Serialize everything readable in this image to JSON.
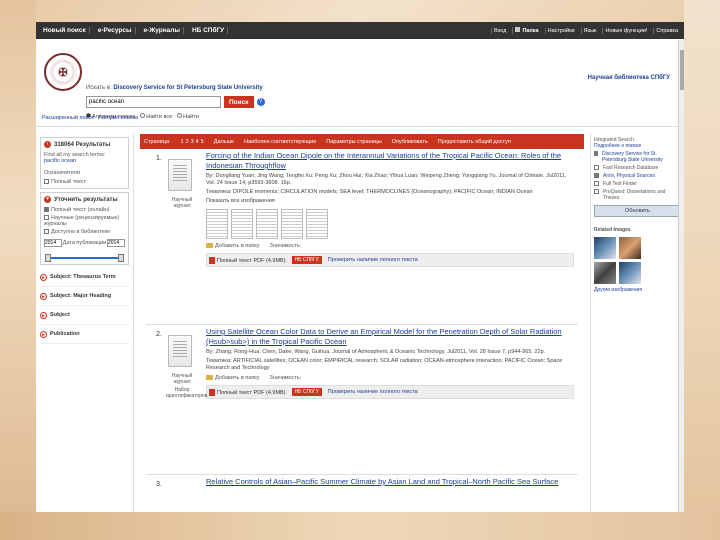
{
  "topbar": {
    "nav": [
      "Новый поиск",
      "e-Ресурсы",
      "e-Журналы",
      "НБ СПбГУ"
    ],
    "right": [
      "Вход",
      "Папка",
      "Настройки",
      "Язык",
      "Новые функции!",
      "Справка"
    ]
  },
  "header": {
    "searching_label": "Искать в:",
    "searching_value": "Discovery Service for St Petersburg State University",
    "query": "pacific ocean",
    "search_button": "Поиск",
    "help": "?",
    "modes": [
      "Алгоритм поиска",
      "Найти все",
      "Найти"
    ],
    "advanced_links": [
      "Расширенный поиск",
      "История поиска"
    ],
    "library_name": "Научная библиотека СПбГУ"
  },
  "left": {
    "results_count": "318064 Результаты",
    "refine_title": "Уточнить результаты",
    "find_all": "Find all my search terms:",
    "find_all_query": "pacific ocean",
    "expanders": "Ограничители",
    "fulltext": "Полный текст",
    "limit_items": [
      "Полный текст (онлайн)",
      "Научные (рецензируемые) журналы",
      "Доступно в библиотеке"
    ],
    "date_from": "2014",
    "date_to": "2014",
    "date_label": "Дата публикации",
    "facets": [
      "Subject: Thesaurus Term",
      "Subject: Major Heading",
      "Subject",
      "Publication"
    ]
  },
  "results": {
    "bar": {
      "label": "Страница:",
      "pages": [
        "1",
        "2",
        "3",
        "4",
        "5"
      ],
      "next": "Дальше",
      "sort": "Наиболее соответствующие",
      "page_options": "Параметры страницы",
      "share": "Опубликовать",
      "alert": "Предоставить общий доступ"
    },
    "items": [
      {
        "num": "1.",
        "title": "Forcing of the Indian Ocean Dipole on the Interannual Variations of the Tropical Pacific Ocean: Roles of the Indonesian Throughflow",
        "meta1": "By: Dongliang Yuan; Jing Wang; Tengfei Xu; Peng Xu; Zhou Hui; Xia Zhao; Yihua Luan; Weipeng Zheng; Yongqiang Yu. Journal of Climate. Jul2011, Vol. 24 Issue 14, p3593-3608. 16p.",
        "meta2": "Тематика: DIPOLE moments; CIRCULATION models; SEA level; THERMOCLINES (Oceanography); PACIFIC Ocean; INDIAN Ocean",
        "type": "Научный журнал",
        "images_label": "Показать все изображения",
        "add_folder": "Добавить в папку",
        "relevancy": "Значимость:",
        "pdf": "Полный текст PDF (4.9MB)",
        "nb": "НБ СПбГУ",
        "check": "Проверить наличие полного текста"
      },
      {
        "num": "2.",
        "title": "Using Satellite Ocean Color Data to Derive an Empirical Model for the Penetration Depth of Solar Radiation (Hsub>sub>) in the Tropical Pacific Ocean",
        "meta1": "By: Zhang, Rong-Hua; Chen, Dake; Wang, Guihua. Journal of Atmospheric & Oceanic Technology. Jul2011, Vol. 28 Issue 7, p944-965. 22p.",
        "meta2": "Тематика: ARTIFICIAL satellites; OCEAN color; EMPIRICAL research; SOLAR radiation; OCEAN-atmosphere interaction; PACIFIC Ocean; Space Research and Technology",
        "type": "Научный журнал",
        "add_folder": "Добавить в папку",
        "relevancy": "Значимость:",
        "pdf": "Полный текст PDF (4.9MB)",
        "nb": "НБ СПбГУ",
        "check": "Проверить наличие полного текста",
        "subtype": "Набор идентификаторов"
      },
      {
        "num": "3.",
        "title": "Relative Controls of Asian–Pacific Summer Climate by Asian Land and Tropical–North Pacific Sea Surface"
      }
    ]
  },
  "right": {
    "header": "Integrated Search",
    "more": "Подробнее о поиске",
    "sources": [
      "Discovery Service for St. Petersburg State University",
      "Fast Research Database",
      "Arxiv, Physical Sources",
      "Full Text Finder",
      "ProQuest: Dissertations and Theses"
    ],
    "update_button": "Обновить",
    "related_images": "Related Images",
    "more_images": "Другие изображения"
  }
}
